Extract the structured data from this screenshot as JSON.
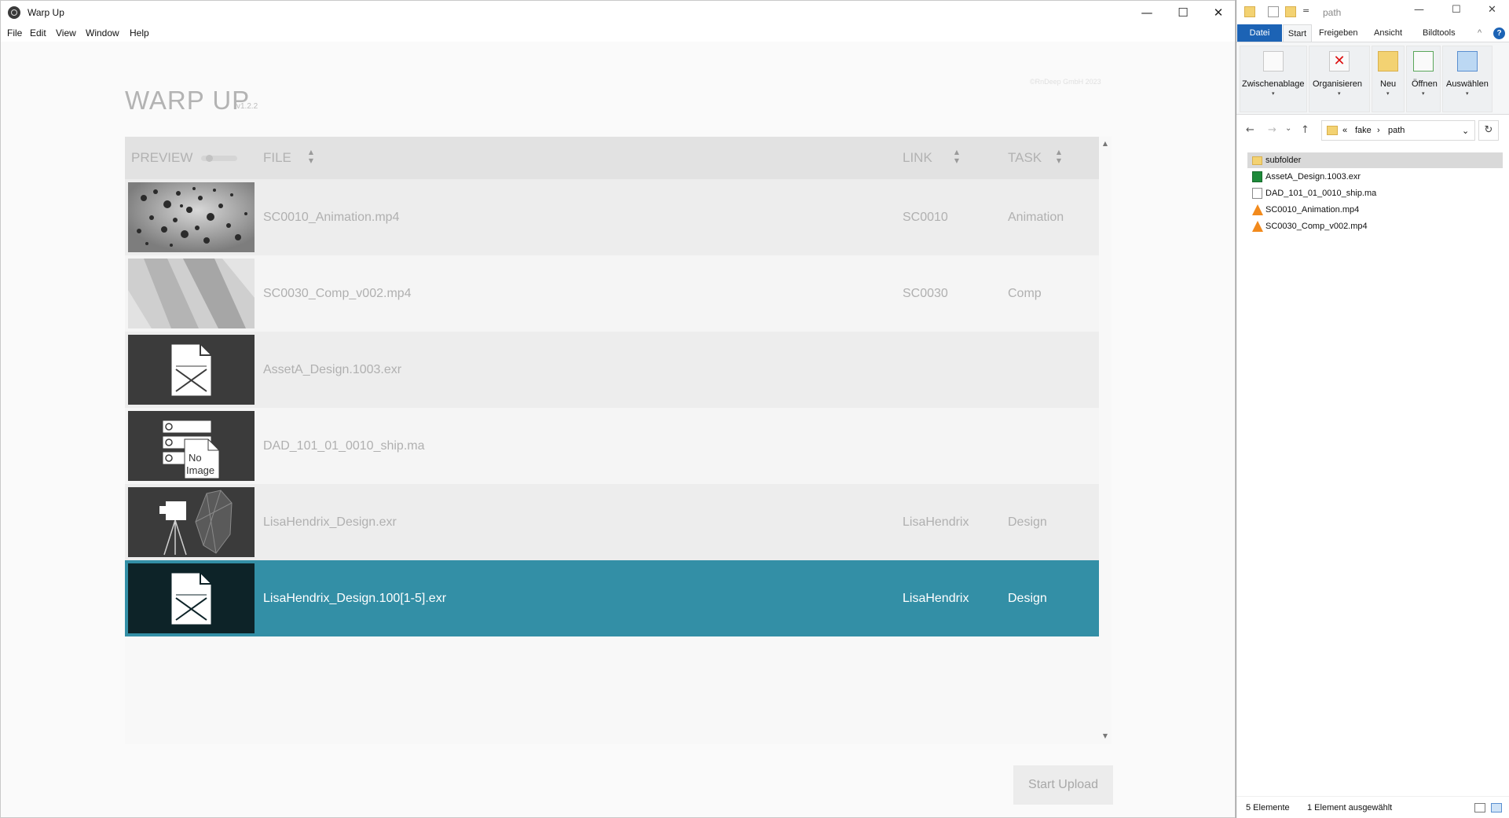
{
  "warp_window": {
    "title": "Warp Up",
    "controls": {
      "minimize": "—",
      "maximize": "☐",
      "close": "✕"
    },
    "menu": [
      "File",
      "Edit",
      "View",
      "Window",
      "Help"
    ],
    "heading": "WARP UP",
    "version": "v1.2.2",
    "copyright": "©RnDeep GmbH 2023",
    "table": {
      "headers": {
        "preview": "PREVIEW",
        "file": "FILE",
        "link": "LINK",
        "task": "TASK"
      },
      "sort_glyph_up": "▲",
      "sort_glyph_down": "▼",
      "rows": [
        {
          "file": "SC0010_Animation.mp4",
          "link": "SC0010",
          "task": "Animation",
          "preview": "particle-render",
          "selected": false
        },
        {
          "file": "SC0030_Comp_v002.mp4",
          "link": "SC0030",
          "task": "Comp",
          "preview": "gray-shapes-render",
          "selected": false
        },
        {
          "file": "AssetA_Design.1003.exr",
          "link": "",
          "task": "",
          "preview": "missing-image-icon",
          "selected": false
        },
        {
          "file": "DAD_101_01_0010_ship.ma",
          "link": "",
          "task": "",
          "preview": "no-image-icon",
          "selected": false
        },
        {
          "file": "LisaHendrix_Design.exr",
          "link": "LisaHendrix",
          "task": "Design",
          "preview": "camera-scene-icon",
          "selected": false
        },
        {
          "file": "LisaHendrix_Design.100[1-5].exr",
          "link": "LisaHendrix",
          "task": "Design",
          "preview": "missing-image-icon",
          "selected": true
        }
      ],
      "no_image_text_1": "No",
      "no_image_text_2": "Image"
    },
    "upload_button": "Start Upload",
    "colors": {
      "selected_row": "#338fa6",
      "header_bg": "#e2e2e2"
    }
  },
  "explorer": {
    "title": "path",
    "quick_access_dropdown": "=",
    "controls": {
      "minimize": "—",
      "maximize": "☐",
      "close": "✕"
    },
    "tabs": [
      "Datei",
      "Start",
      "Freigeben",
      "Ansicht",
      "Bildtools"
    ],
    "ribbon_collapse": "^",
    "help": "?",
    "ribbon": [
      {
        "label": "Zwischenablage",
        "icon": "clipboard-icon"
      },
      {
        "label": "Organisieren",
        "icon": "delete-icon"
      },
      {
        "label": "Neu",
        "icon": "new-folder-icon"
      },
      {
        "label": "Öffnen",
        "icon": "open-icon"
      },
      {
        "label": "Auswählen",
        "icon": "select-icon"
      }
    ],
    "ribbon_caret": "▾",
    "nav": {
      "back": "←",
      "forward": "→",
      "recent": "⌄",
      "up": "↑"
    },
    "address": {
      "chevron": "«",
      "segment_1": "fake",
      "separator": "›",
      "segment_2": "path",
      "dropdown": "⌄"
    },
    "refresh": "↻",
    "files": [
      {
        "name": "subfolder",
        "type": "folder",
        "selected": true
      },
      {
        "name": "AssetA_Design.1003.exr",
        "type": "image",
        "selected": false
      },
      {
        "name": "DAD_101_01_0010_ship.ma",
        "type": "doc",
        "selected": false
      },
      {
        "name": "SC0010_Animation.mp4",
        "type": "vlc",
        "selected": false
      },
      {
        "name": "SC0030_Comp_v002.mp4",
        "type": "vlc",
        "selected": false
      }
    ],
    "status": {
      "count": "5 Elemente",
      "selection": "1 Element ausgewählt"
    },
    "colors": {
      "datei_tab": "#1c63b5",
      "folder": "#f3d272"
    }
  }
}
